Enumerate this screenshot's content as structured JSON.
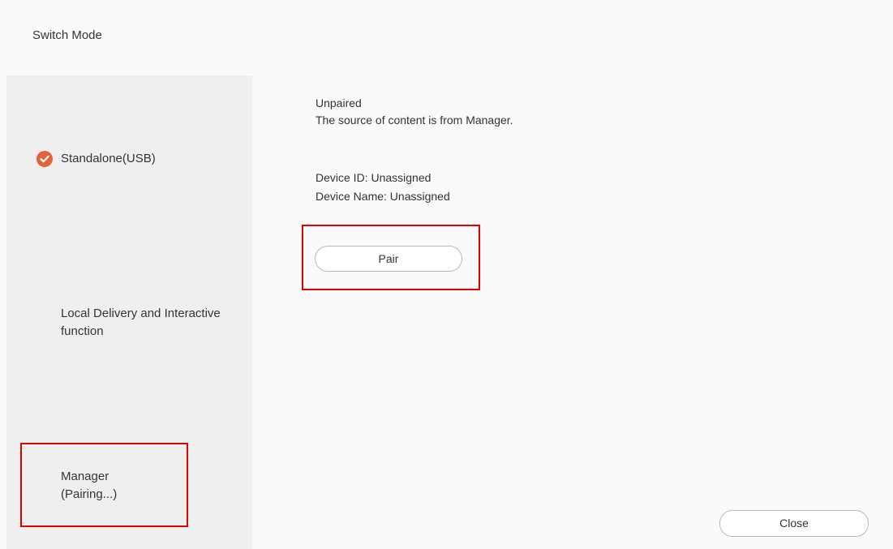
{
  "dialog": {
    "title": "Switch Mode"
  },
  "sidebar": {
    "items": [
      {
        "label": "Standalone(USB)",
        "selected": true,
        "icon": "check-circle-icon"
      },
      {
        "label": "Local Delivery and Interactive\nfunction",
        "selected": false
      },
      {
        "label": "Manager\n(Pairing...)",
        "selected": false
      }
    ]
  },
  "main": {
    "status": "Unpaired",
    "source_text": "The source of content is from Manager.",
    "device_id": "Device ID: Unassigned",
    "device_name": "Device Name: Unassigned",
    "pair_label": "Pair"
  },
  "footer": {
    "close_label": "Close"
  },
  "colors": {
    "accent": "#e2633a",
    "highlight": "#e30000",
    "sidebar_bg": "#efefef",
    "page_bg": "#fafafa"
  }
}
